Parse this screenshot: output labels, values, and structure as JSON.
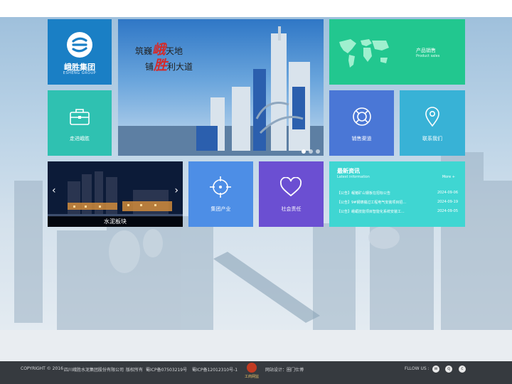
{
  "brand": {
    "name_cn": "峨胜集团",
    "name_en": "ESHENG GROUP"
  },
  "banner": {
    "line1_left": "筑巍",
    "line1_red": "峨",
    "line1_right": "天地",
    "line2_left": "铺",
    "line2_red": "胜",
    "line2_right": "利大道",
    "slide_count": 3,
    "active_slide": 1
  },
  "tiles": {
    "sales": {
      "cn": "产品销售",
      "en": "Product sales"
    },
    "about": {
      "label": "走进峨胜"
    },
    "channel": {
      "label": "销售渠道"
    },
    "contact": {
      "label": "联系我们"
    },
    "cement": {
      "label": "水泥板块"
    },
    "industry": {
      "label": "集团产业"
    },
    "social": {
      "label": "社会责任"
    }
  },
  "news": {
    "title": "最新资讯",
    "subtitle": "Latest information",
    "more": "More +",
    "items": [
      {
        "title": "【公告】岷猪矿山钢板在招标公告",
        "date": "2024-09-06"
      },
      {
        "title": "【公告】9#钢铸橇过工程电气安装项目招...",
        "date": "2024-09-19"
      },
      {
        "title": "【公告】峨嵋技能项目智能化系统安装工...",
        "date": "2024-09-05"
      }
    ]
  },
  "footer": {
    "copyright": "COPYRIGHT © 2016",
    "company": "四川峨胜水泥集团股份有限公司",
    "rights": "版权所有",
    "icp1": "蜀ICP备07503219号",
    "icp2": "蜀ICP备12012310号-1",
    "badge_text": "工商网监",
    "design": "网站设计：圈门仕博",
    "follow": "FLLOW US :"
  },
  "colors": {
    "logo": "#1a7fc5",
    "sales": "#22c78f",
    "about": "#2fc1b1",
    "channel": "#4a77d6",
    "contact": "#38b2d6",
    "industry": "#4d8ee6",
    "social": "#6b4fd2",
    "news": "#3fd6d2",
    "footer": "#363a3f"
  },
  "icons": {
    "sales": "world-map-icon",
    "about": "briefcase-icon",
    "channel": "lifebuoy-icon",
    "contact": "location-pin-icon",
    "industry": "crosshair-icon",
    "social": "heart-icon"
  }
}
